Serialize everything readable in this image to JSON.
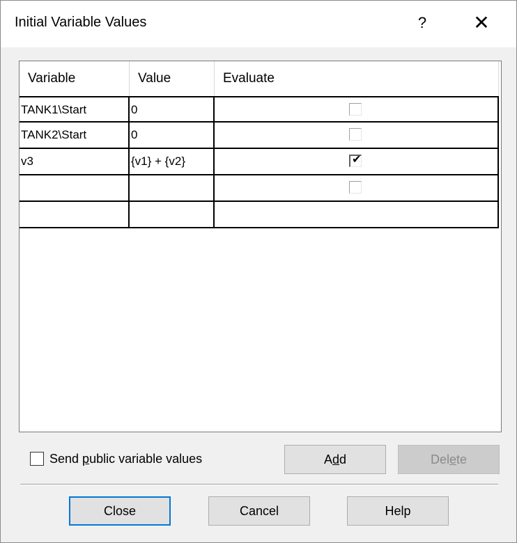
{
  "window": {
    "title": "Initial Variable Values",
    "help_glyph": "?",
    "close_glyph": "✕"
  },
  "grid": {
    "columns": [
      "Variable",
      "Value",
      "Evaluate"
    ],
    "rows": [
      {
        "variable": "TANK1\\Start",
        "value": "0",
        "evaluate_checkbox": true,
        "evaluate": false
      },
      {
        "variable": "TANK2\\Start",
        "value": "0",
        "evaluate_checkbox": true,
        "evaluate": false
      },
      {
        "variable": "v3",
        "value": "{v1} + {v2}",
        "evaluate_checkbox": true,
        "evaluate": true
      },
      {
        "variable": "",
        "value": "",
        "evaluate_checkbox": true,
        "evaluate": false
      },
      {
        "variable": "",
        "value": "",
        "evaluate_checkbox": false,
        "evaluate": false
      }
    ]
  },
  "options": {
    "send_public_label_pre": "Send ",
    "send_public_label_accel": "p",
    "send_public_label_post": "ublic variable values",
    "send_public_checked": false
  },
  "buttons": {
    "add_pre": "A",
    "add_accel": "d",
    "add_post": "d",
    "delete_pre": "Del",
    "delete_accel": "e",
    "delete_post": "te",
    "close": "Close",
    "cancel": "Cancel",
    "help": "Help"
  },
  "colors": {
    "default_button_border": "#0078d7",
    "disabled_text": "#8a8a8a"
  }
}
